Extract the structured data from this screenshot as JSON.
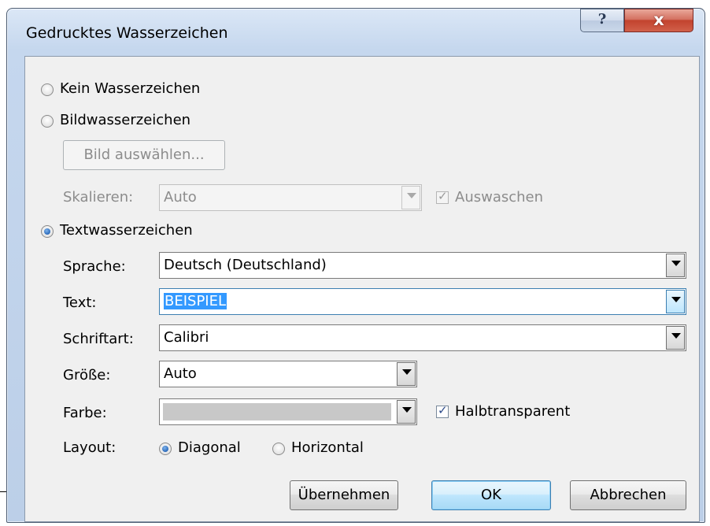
{
  "window": {
    "title": "Gedrucktes Wasserzeichen",
    "help_glyph": "?",
    "close_glyph": "x"
  },
  "options": {
    "no_watermark_label": "Kein Wasserzeichen",
    "picture_watermark_label": "Bildwasserzeichen",
    "text_watermark_label": "Textwasserzeichen",
    "selected": "Textwasserzeichen"
  },
  "picture": {
    "select_picture_label": "Bild auswählen...",
    "scale_label": "Skalieren:",
    "scale_value": "Auto",
    "washout_label": "Auswaschen",
    "washout_checked": true
  },
  "text_settings": {
    "language_label": "Sprache:",
    "language_value": "Deutsch (Deutschland)",
    "text_label": "Text:",
    "text_value": "BEISPIEL",
    "font_label": "Schriftart:",
    "font_value": "Calibri",
    "size_label": "Größe:",
    "size_value": "Auto",
    "color_label": "Farbe:",
    "color_value": "#c8c8c8",
    "semitransparent_label": "Halbtransparent",
    "semitransparent_checked": true,
    "layout_label": "Layout:",
    "layout_diagonal": "Diagonal",
    "layout_horizontal": "Horizontal",
    "layout_selected": "Diagonal"
  },
  "buttons": {
    "apply": "Übernehmen",
    "ok": "OK",
    "cancel": "Abbrechen"
  }
}
